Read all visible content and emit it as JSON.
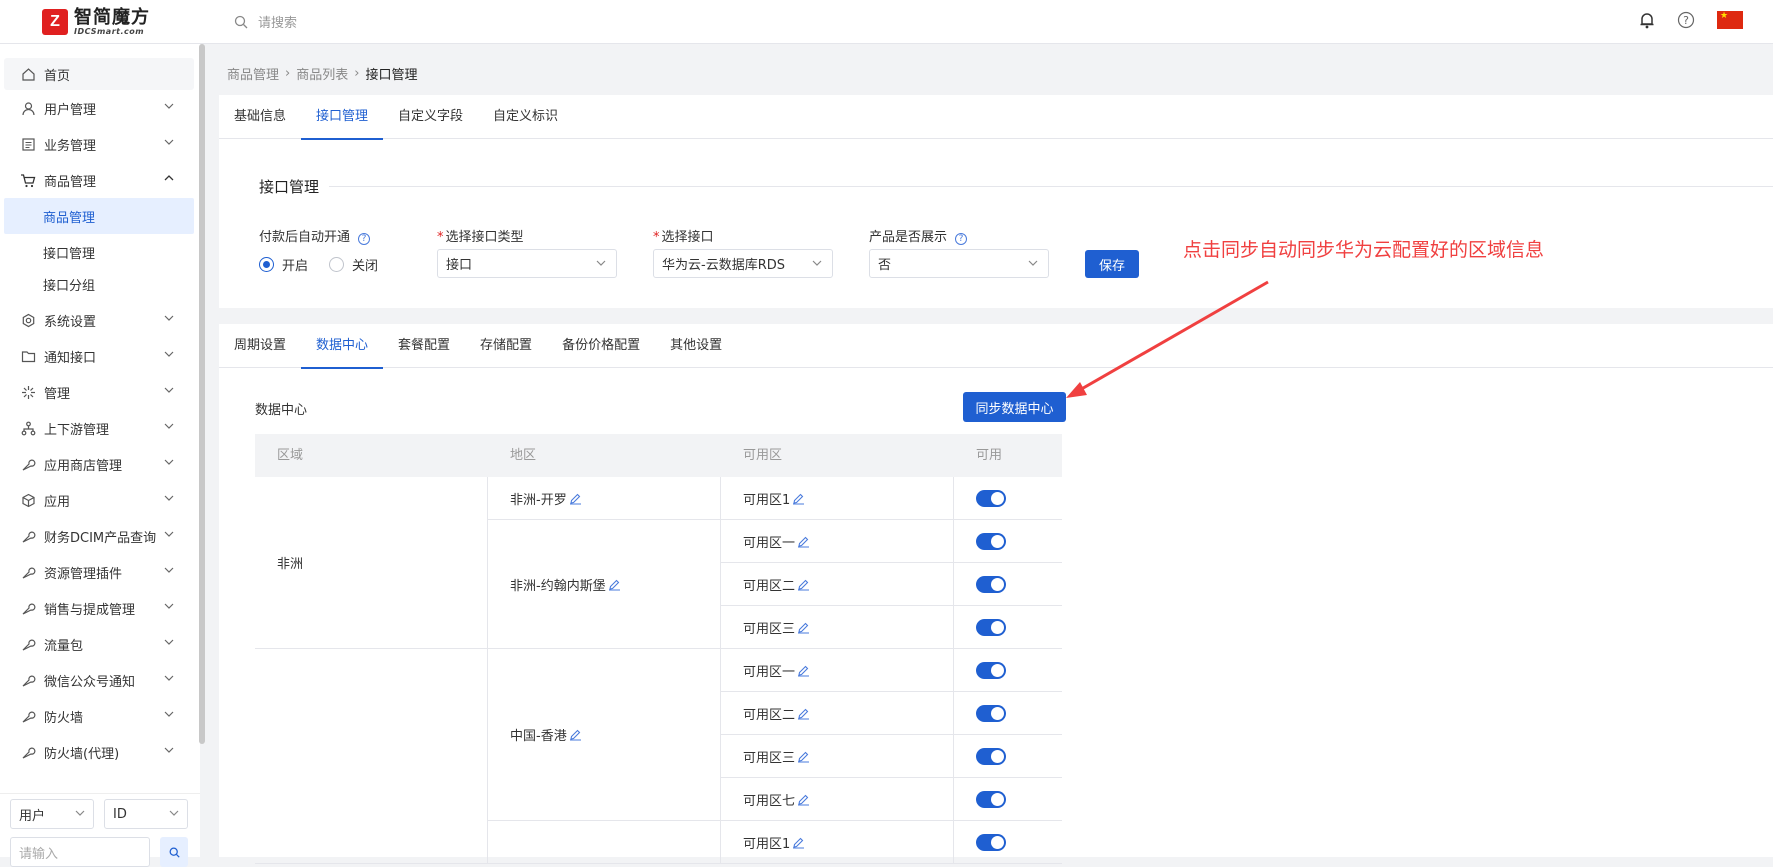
{
  "header": {
    "logo_mark": "Z",
    "logo_cn": "智简魔方",
    "logo_en": "IDCSmart.com",
    "search_placeholder": "请搜索"
  },
  "sidebar": {
    "home": "首页",
    "items": [
      {
        "label": "用户管理",
        "icon": "user-icon"
      },
      {
        "label": "业务管理",
        "icon": "list-icon"
      },
      {
        "label": "商品管理",
        "icon": "cart-icon",
        "expanded": true
      }
    ],
    "sub_items": [
      "商品管理",
      "接口管理",
      "接口分组"
    ],
    "items2": [
      {
        "label": "系统设置",
        "icon": "gear-icon"
      },
      {
        "label": "通知接口",
        "icon": "folder-icon"
      },
      {
        "label": "管理",
        "icon": "sparkle-icon"
      },
      {
        "label": "上下游管理",
        "icon": "tree-icon"
      },
      {
        "label": "应用商店管理",
        "icon": "wrench-icon"
      },
      {
        "label": "应用",
        "icon": "box-icon"
      },
      {
        "label": "财务DCIM产品查询",
        "icon": "wrench-icon"
      },
      {
        "label": "资源管理插件",
        "icon": "wrench-icon"
      },
      {
        "label": "销售与提成管理",
        "icon": "wrench-icon"
      },
      {
        "label": "流量包",
        "icon": "wrench-icon"
      },
      {
        "label": "微信公众号通知",
        "icon": "wrench-icon"
      },
      {
        "label": "防火墙",
        "icon": "wrench-icon"
      },
      {
        "label": "防火墙(代理)",
        "icon": "wrench-icon"
      }
    ],
    "bottom": {
      "select1": "用户",
      "select2": "ID",
      "input_placeholder": "请输入"
    }
  },
  "breadcrumb": [
    "商品管理",
    "商品列表",
    "接口管理"
  ],
  "top_tabs": [
    "基础信息",
    "接口管理",
    "自定义字段",
    "自定义标识"
  ],
  "api_section": {
    "title": "接口管理",
    "auto_open_label": "付款后自动开通",
    "radio_on": "开启",
    "radio_off": "关闭",
    "type_label": "选择接口类型",
    "type_value": "接口",
    "api_label": "选择接口",
    "api_value": "华为云-云数据库RDS",
    "show_label": "产品是否展示",
    "show_value": "否",
    "save_label": "保存"
  },
  "sub_tabs": [
    "周期设置",
    "数据中心",
    "套餐配置",
    "存储配置",
    "备份价格配置",
    "其他设置"
  ],
  "datacenter": {
    "label": "数据中心",
    "sync_label": "同步数据中心",
    "headers": [
      "区域",
      "地区",
      "可用区",
      "可用"
    ],
    "regions": [
      {
        "name": "非洲",
        "areas": [
          {
            "name": "非洲-开罗",
            "zones": [
              "可用区1"
            ]
          },
          {
            "name": "非洲-约翰内斯堡",
            "zones": [
              "可用区一",
              "可用区二",
              "可用区三"
            ]
          }
        ]
      },
      {
        "name": "",
        "areas": [
          {
            "name": "中国-香港",
            "zones": [
              "可用区一",
              "可用区二",
              "可用区三",
              "可用区七"
            ]
          },
          {
            "name": "",
            "zones": [
              "可用区1"
            ]
          }
        ]
      }
    ]
  },
  "annotation": "点击同步自动同步华为云配置好的区域信息",
  "colors": {
    "primary": "#1f5fd1",
    "annotation": "#f04040",
    "logo": "#e02020"
  }
}
